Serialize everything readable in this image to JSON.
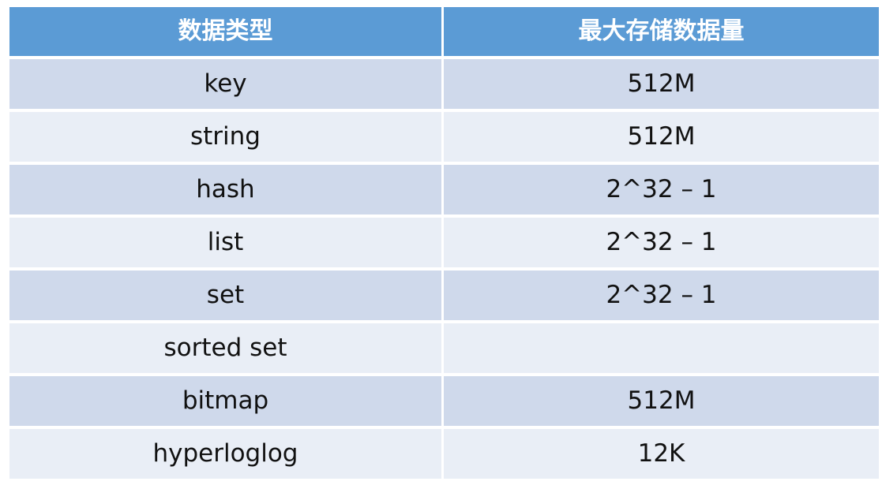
{
  "table": {
    "headers": [
      "数据类型",
      "最大存储数据量"
    ],
    "rows": [
      [
        "key",
        "512M"
      ],
      [
        "string",
        "512M"
      ],
      [
        "hash",
        "2^32 – 1"
      ],
      [
        "list",
        "2^32 – 1"
      ],
      [
        "set",
        "2^32 – 1"
      ],
      [
        "sorted set",
        ""
      ],
      [
        "bitmap",
        "512M"
      ],
      [
        "hyperloglog",
        "12K"
      ]
    ]
  },
  "colors": {
    "header_bg": "#5b9bd5",
    "header_text": "#ffffff",
    "row_dark": "#cfd9eb",
    "row_light": "#e9eef6",
    "text": "#111111"
  }
}
